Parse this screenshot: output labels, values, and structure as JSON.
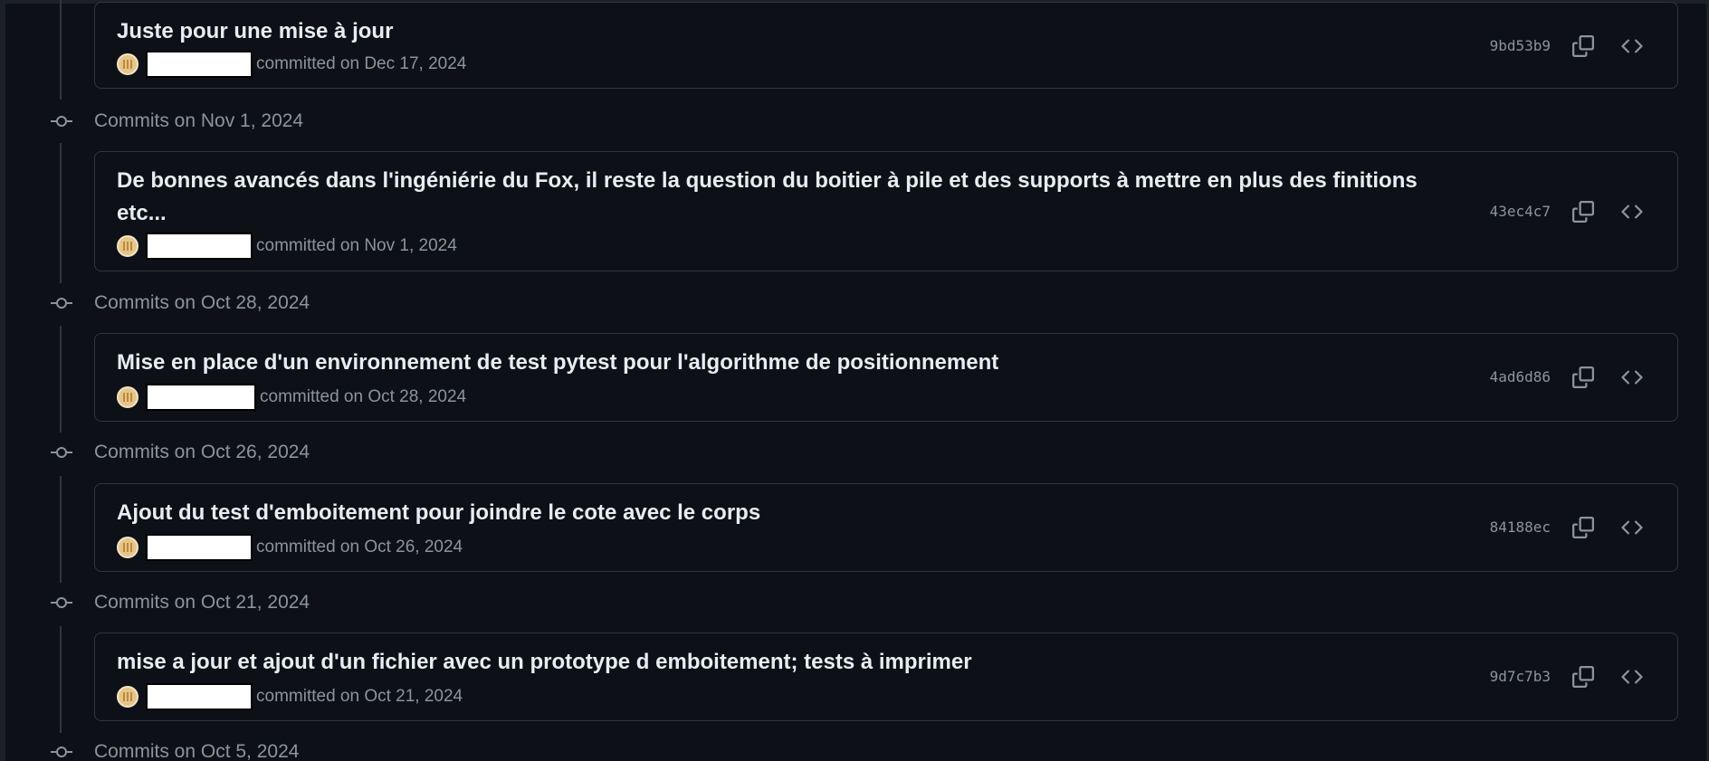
{
  "colors": {
    "background": "#0d1117",
    "border": "#30363d",
    "text_primary": "#e6edf3",
    "text_muted": "#8b949e"
  },
  "icons": {
    "copy": "copy-icon",
    "browse": "code-icon",
    "commit_node": "git-commit-icon"
  },
  "commits": [
    {
      "message": "Juste pour une mise à jour",
      "meta": "committed on Dec 17, 2024",
      "sha": "9bd53b9"
    }
  ],
  "groups": [
    {
      "title": "Commits on Nov 1, 2024",
      "commit": {
        "message": "De bonnes avancés dans l'ingéniérie du Fox, il reste la question du boitier à pile et des supports à mettre en plus des finitions etc...",
        "meta": "committed on Nov 1, 2024",
        "sha": "43ec4c7"
      }
    },
    {
      "title": "Commits on Oct 28, 2024",
      "commit": {
        "message": "Mise en place d'un environnement de test pytest pour l'algorithme de positionnement",
        "meta": "committed on Oct 28, 2024",
        "sha": "4ad6d86"
      }
    },
    {
      "title": "Commits on Oct 26, 2024",
      "commit": {
        "message": "Ajout du test d'emboitement pour joindre le cote avec le corps",
        "meta": "committed on Oct 26, 2024",
        "sha": "84188ec"
      }
    },
    {
      "title": "Commits on Oct 21, 2024",
      "commit": {
        "message": "mise a jour et ajout d'un fichier avec un prototype d emboitement; tests à imprimer",
        "meta": "committed on Oct 21, 2024",
        "sha": "9d7c7b3"
      }
    },
    {
      "title": "Commits on Oct 5, 2024"
    }
  ]
}
